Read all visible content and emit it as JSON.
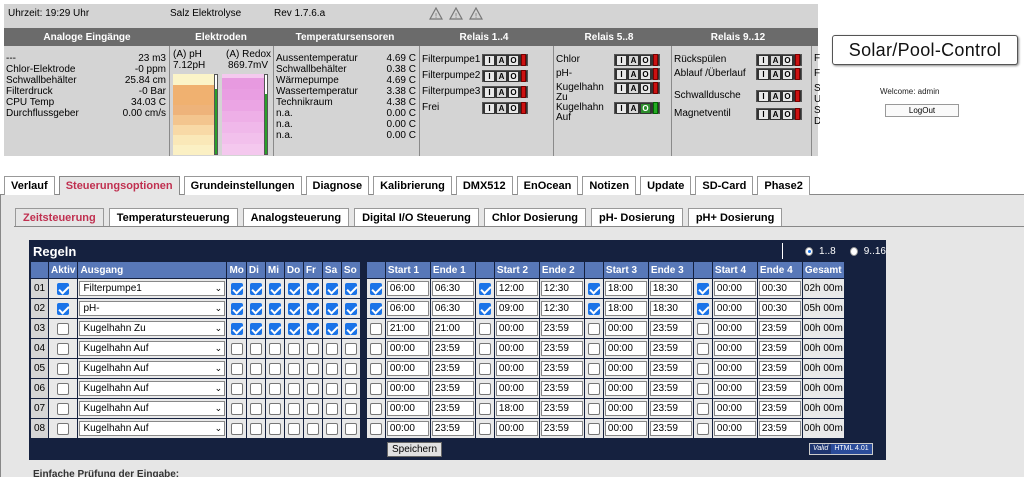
{
  "statusbar": {
    "uptime": "Uhrzeit: 19:29 Uhr",
    "mode": "Salz Elektrolyse",
    "revision": "Rev 1.7.6.a"
  },
  "section_headers": {
    "analog": "Analoge Eingänge",
    "electrodes": "Elektroden",
    "temperature": "Temperatursensoren",
    "relays_1_4": "Relais 1..4",
    "relays_5_8": "Relais 5..8",
    "relays_9_12": "Relais 9..12"
  },
  "analog_inputs": [
    {
      "label": "---",
      "value": "23 m3"
    },
    {
      "label": "Chlor-Elektrode",
      "value": "-0 ppm"
    },
    {
      "label": "Schwallbehälter",
      "value": "25.84 cm"
    },
    {
      "label": "Filterdruck",
      "value": "-0 Bar"
    },
    {
      "label": "CPU Temp",
      "value": "34.03 C"
    },
    {
      "label": "Durchflussgeber",
      "value": "0.00 cm/s"
    }
  ],
  "electrodes": {
    "ph_label": "(A) pH",
    "ph_value": "7.12pH",
    "redox_label": "(A) Redox",
    "redox_value": "869.7mV",
    "ph_level": 0.82,
    "redox_level": 0.76
  },
  "temperature_sensors": [
    {
      "label": "Aussentemperatur",
      "value": "4.69 C"
    },
    {
      "label": "Schwallbehälter",
      "value": "0.38 C"
    },
    {
      "label": "Wärmepumpe",
      "value": "4.69 C"
    },
    {
      "label": "Wassertemperatur",
      "value": "3.38 C"
    },
    {
      "label": "Technikraum",
      "value": "4.38 C"
    },
    {
      "label": "n.a.",
      "value": "0.00 C"
    },
    {
      "label": "n.a.",
      "value": "0.00 C"
    },
    {
      "label": "n.a.",
      "value": "0.00 C"
    }
  ],
  "relays_1_4": [
    "Filterpumpe1",
    "Filterpumpe2",
    "Filterpumpe3",
    "Frei"
  ],
  "relays_5_8": [
    "Chlor",
    "pH-",
    "Kugelhahn Zu",
    "Kugelhahn Auf"
  ],
  "relays_9_12": [
    "Rückspülen",
    "Ablauf /Überlauf",
    "Schwalldusche",
    "Magnetventil"
  ],
  "relay_buttons": {
    "i": "I",
    "a": "A",
    "o": "O"
  },
  "right_partial": {
    "c1": "F",
    "c2": "F",
    "c3": "S",
    "c4": "U",
    "c5": "S",
    "c6": "D"
  },
  "header_right": {
    "logo": "Solar/Pool-Control",
    "welcome": "Welcome: admin",
    "logout": "LogOut"
  },
  "main_tabs": [
    "Verlauf",
    "Steuerungsoptionen",
    "Grundeinstellungen",
    "Diagnose",
    "Kalibrierung",
    "DMX512",
    "EnOcean",
    "Notizen",
    "Update",
    "SD-Card",
    "Phase2"
  ],
  "main_tab_active": 1,
  "sub_tabs": [
    "Zeitsteuerung",
    "Temperatursteuerung",
    "Analogsteuerung",
    "Digital I/O Steuerung",
    "Chlor Dosierung",
    "pH- Dosierung",
    "pH+ Dosierung"
  ],
  "sub_tab_active": 0,
  "rules": {
    "title": "Regeln",
    "range_1": "1..8",
    "range_2": "9..16",
    "columns": {
      "aktiv": "Aktiv",
      "ausgang": "Ausgang",
      "days": [
        "Mo",
        "Di",
        "Mi",
        "Do",
        "Fr",
        "Sa",
        "So"
      ],
      "start1": "Start 1",
      "end1": "Ende 1",
      "start2": "Start 2",
      "end2": "Ende 2",
      "start3": "Start 3",
      "end3": "Ende 3",
      "start4": "Start 4",
      "end4": "Ende 4",
      "total": "Gesamt"
    },
    "rows": [
      {
        "num": "01",
        "active": true,
        "output": "Filterpumpe1",
        "days": [
          true,
          true,
          true,
          true,
          true,
          true,
          true
        ],
        "slots": [
          {
            "on": true,
            "start": "06:00",
            "end": "06:30"
          },
          {
            "on": true,
            "start": "12:00",
            "end": "12:30"
          },
          {
            "on": true,
            "start": "18:00",
            "end": "18:30"
          },
          {
            "on": true,
            "start": "00:00",
            "end": "00:30"
          }
        ],
        "total": "02h 00m"
      },
      {
        "num": "02",
        "active": true,
        "output": "pH-",
        "days": [
          true,
          true,
          true,
          true,
          true,
          true,
          true
        ],
        "slots": [
          {
            "on": true,
            "start": "06:00",
            "end": "06:30"
          },
          {
            "on": true,
            "start": "09:00",
            "end": "12:30"
          },
          {
            "on": true,
            "start": "18:00",
            "end": "18:30"
          },
          {
            "on": true,
            "start": "00:00",
            "end": "00:30"
          }
        ],
        "total": "05h 00m"
      },
      {
        "num": "03",
        "active": false,
        "output": "Kugelhahn Zu",
        "days": [
          true,
          true,
          true,
          true,
          true,
          true,
          true
        ],
        "slots": [
          {
            "on": false,
            "start": "21:00",
            "end": "21:00"
          },
          {
            "on": false,
            "start": "00:00",
            "end": "23:59"
          },
          {
            "on": false,
            "start": "00:00",
            "end": "23:59"
          },
          {
            "on": false,
            "start": "00:00",
            "end": "23:59"
          }
        ],
        "total": "00h 00m"
      },
      {
        "num": "04",
        "active": false,
        "output": "Kugelhahn Auf",
        "days": [
          false,
          false,
          false,
          false,
          false,
          false,
          false
        ],
        "slots": [
          {
            "on": false,
            "start": "00:00",
            "end": "23:59"
          },
          {
            "on": false,
            "start": "00:00",
            "end": "23:59"
          },
          {
            "on": false,
            "start": "00:00",
            "end": "23:59"
          },
          {
            "on": false,
            "start": "00:00",
            "end": "23:59"
          }
        ],
        "total": "00h 00m"
      },
      {
        "num": "05",
        "active": false,
        "output": "Kugelhahn Auf",
        "days": [
          false,
          false,
          false,
          false,
          false,
          false,
          false
        ],
        "slots": [
          {
            "on": false,
            "start": "00:00",
            "end": "23:59"
          },
          {
            "on": false,
            "start": "00:00",
            "end": "23:59"
          },
          {
            "on": false,
            "start": "00:00",
            "end": "23:59"
          },
          {
            "on": false,
            "start": "00:00",
            "end": "23:59"
          }
        ],
        "total": "00h 00m"
      },
      {
        "num": "06",
        "active": false,
        "output": "Kugelhahn Auf",
        "days": [
          false,
          false,
          false,
          false,
          false,
          false,
          false
        ],
        "slots": [
          {
            "on": false,
            "start": "00:00",
            "end": "23:59"
          },
          {
            "on": false,
            "start": "00:00",
            "end": "23:59"
          },
          {
            "on": false,
            "start": "00:00",
            "end": "23:59"
          },
          {
            "on": false,
            "start": "00:00",
            "end": "23:59"
          }
        ],
        "total": "00h 00m"
      },
      {
        "num": "07",
        "active": false,
        "output": "Kugelhahn Auf",
        "days": [
          false,
          false,
          false,
          false,
          false,
          false,
          false
        ],
        "slots": [
          {
            "on": false,
            "start": "00:00",
            "end": "23:59"
          },
          {
            "on": false,
            "start": "18:00",
            "end": "23:59"
          },
          {
            "on": false,
            "start": "00:00",
            "end": "23:59"
          },
          {
            "on": false,
            "start": "00:00",
            "end": "23:59"
          }
        ],
        "total": "00h 00m"
      },
      {
        "num": "08",
        "active": false,
        "output": "Kugelhahn Auf",
        "days": [
          false,
          false,
          false,
          false,
          false,
          false,
          false
        ],
        "slots": [
          {
            "on": false,
            "start": "00:00",
            "end": "23:59"
          },
          {
            "on": false,
            "start": "00:00",
            "end": "23:59"
          },
          {
            "on": false,
            "start": "00:00",
            "end": "23:59"
          },
          {
            "on": false,
            "start": "00:00",
            "end": "23:59"
          }
        ],
        "total": "00h 00m"
      }
    ],
    "save": "Speichern",
    "badge_a": "Valid",
    "badge_b": "HTML 4.01"
  },
  "bottom_text": "Einfache Prüfung der Eingabe:"
}
